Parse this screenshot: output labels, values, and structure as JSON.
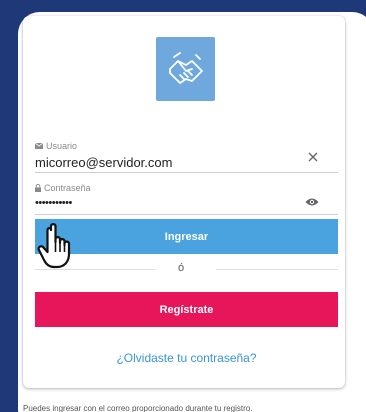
{
  "colors": {
    "background": "#1f3878",
    "primary": "#4aa3df",
    "danger": "#e7155a",
    "link": "#3b95d6",
    "logo": "#6ea8dc"
  },
  "logo": {
    "icon": "handshake-icon"
  },
  "username": {
    "label": "Usuario",
    "value": "micorreo@servidor.com",
    "label_icon": "envelope-icon",
    "clear_icon": "close-icon"
  },
  "password": {
    "label": "Contraseña",
    "value": "•••••••••••",
    "label_icon": "lock-icon",
    "toggle_icon": "eye-icon"
  },
  "login_button": {
    "label": "Ingresar"
  },
  "divider": {
    "text": "ó"
  },
  "register_button": {
    "label": "Regístrate"
  },
  "forgot_link": {
    "label": "¿Olvidaste tu contraseña?"
  },
  "footer": {
    "text": "Puedes ingresar con el correo proporcionado durante tu registro."
  },
  "cursor": {
    "icon": "pointer-hand-icon"
  }
}
